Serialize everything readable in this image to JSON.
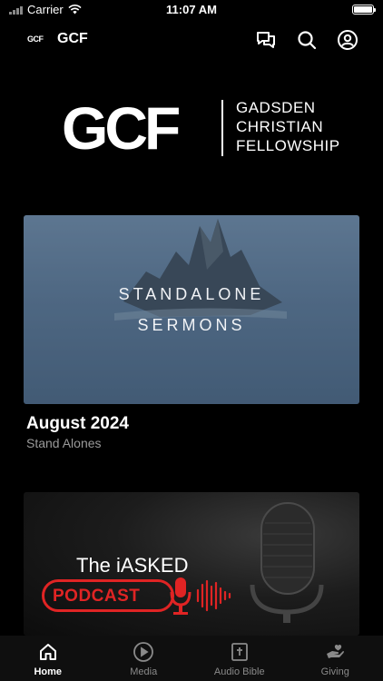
{
  "status_bar": {
    "carrier": "Carrier",
    "time": "11:07 AM"
  },
  "nav": {
    "logo_text": "GCF",
    "title": "GCF",
    "icons": [
      "chat-icon",
      "search-icon",
      "profile-icon"
    ]
  },
  "brand": {
    "mark": "GCF",
    "lines": [
      "GADSDEN",
      "CHRISTIAN",
      "FELLOWSHIP"
    ]
  },
  "cards": [
    {
      "overlay_lines": [
        "STANDALONE",
        "SERMONS"
      ],
      "title": "August 2024",
      "subtitle": "Stand Alones"
    },
    {
      "heading": "The iASKED",
      "badge": "PODCAST"
    }
  ],
  "tabs": [
    {
      "label": "Home",
      "icon": "home-icon",
      "active": true
    },
    {
      "label": "Media",
      "icon": "play-icon",
      "active": false
    },
    {
      "label": "Audio Bible",
      "icon": "bible-icon",
      "active": false
    },
    {
      "label": "Giving",
      "icon": "giving-hand-icon",
      "active": false
    }
  ],
  "colors": {
    "background": "#000000",
    "accent_red": "#e02424",
    "tab_bar": "#0f0f0f",
    "inactive": "#8a8a8a"
  }
}
